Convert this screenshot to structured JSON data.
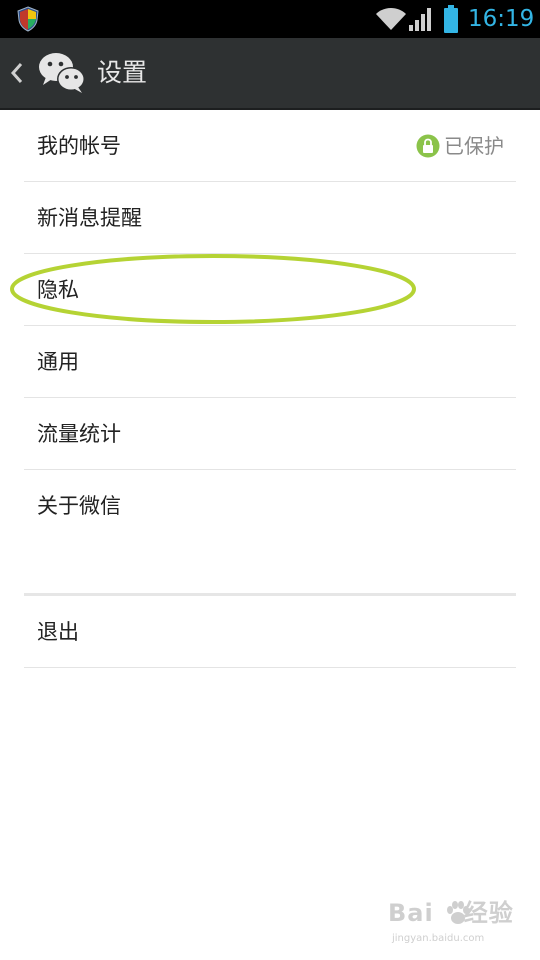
{
  "status_bar": {
    "time": "16:19",
    "icons": [
      "shield-icon",
      "wifi-icon",
      "signal-icon",
      "battery-icon"
    ],
    "accent_color": "#33b5e5"
  },
  "action_bar": {
    "title": "设置",
    "back_icon": "chevron-left-icon",
    "logo_icon": "wechat-logo-icon"
  },
  "settings": {
    "items": [
      {
        "label": "我的帐号",
        "status": "已保护",
        "status_icon": "lock-icon"
      },
      {
        "label": "新消息提醒"
      },
      {
        "label": "隐私"
      },
      {
        "label": "通用"
      },
      {
        "label": "流量统计"
      },
      {
        "label": "关于微信"
      }
    ],
    "logout_label": "退出"
  },
  "annotation": {
    "highlight_color": "#b5d334"
  },
  "watermark": {
    "brand_a": "Bai",
    "brand_b": "经验",
    "url": "jingyan.baidu.com"
  }
}
